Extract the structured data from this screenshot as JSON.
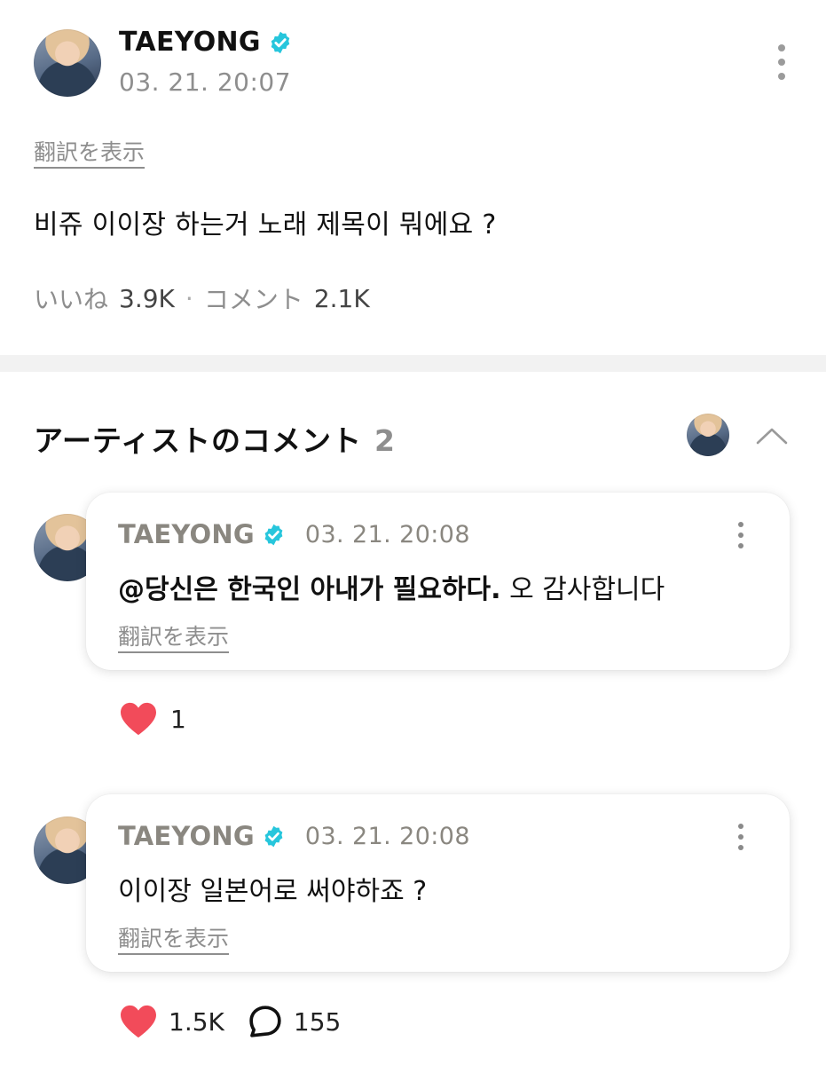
{
  "post": {
    "author": "TAEYONG",
    "timestamp": "03. 21. 20:07",
    "translate_label": "翻訳を表示",
    "body": "비쥬 이이장 하는거 노래 제목이 뭐에요 ?",
    "stats": {
      "likes_label": "いいね",
      "likes_count": "3.9K",
      "separator": "·",
      "comments_label": "コメント",
      "comments_count": "2.1K"
    }
  },
  "artist_comments": {
    "title": "アーティストのコメント",
    "count": "2",
    "items": [
      {
        "author": "TAEYONG",
        "timestamp": "03. 21. 20:08",
        "mention": "@당신은 한국인 아내가 필요하다.",
        "text": " 오 감사합니다",
        "translate_label": "翻訳を表示",
        "likes": "1"
      },
      {
        "author": "TAEYONG",
        "timestamp": "03. 21. 20:08",
        "text": "이이장 일본어로 써야하죠 ?",
        "translate_label": "翻訳を表示",
        "likes": "1.5K",
        "replies": "155"
      }
    ]
  },
  "colors": {
    "verified": "#27c6dc",
    "heart": "#f24b5a",
    "divider": "#f2f2f2",
    "muted": "#8e8e8e"
  },
  "icons": [
    "verified-badge-icon",
    "more-vertical-icon",
    "chevron-up-icon",
    "heart-icon",
    "comment-bubble-icon"
  ]
}
